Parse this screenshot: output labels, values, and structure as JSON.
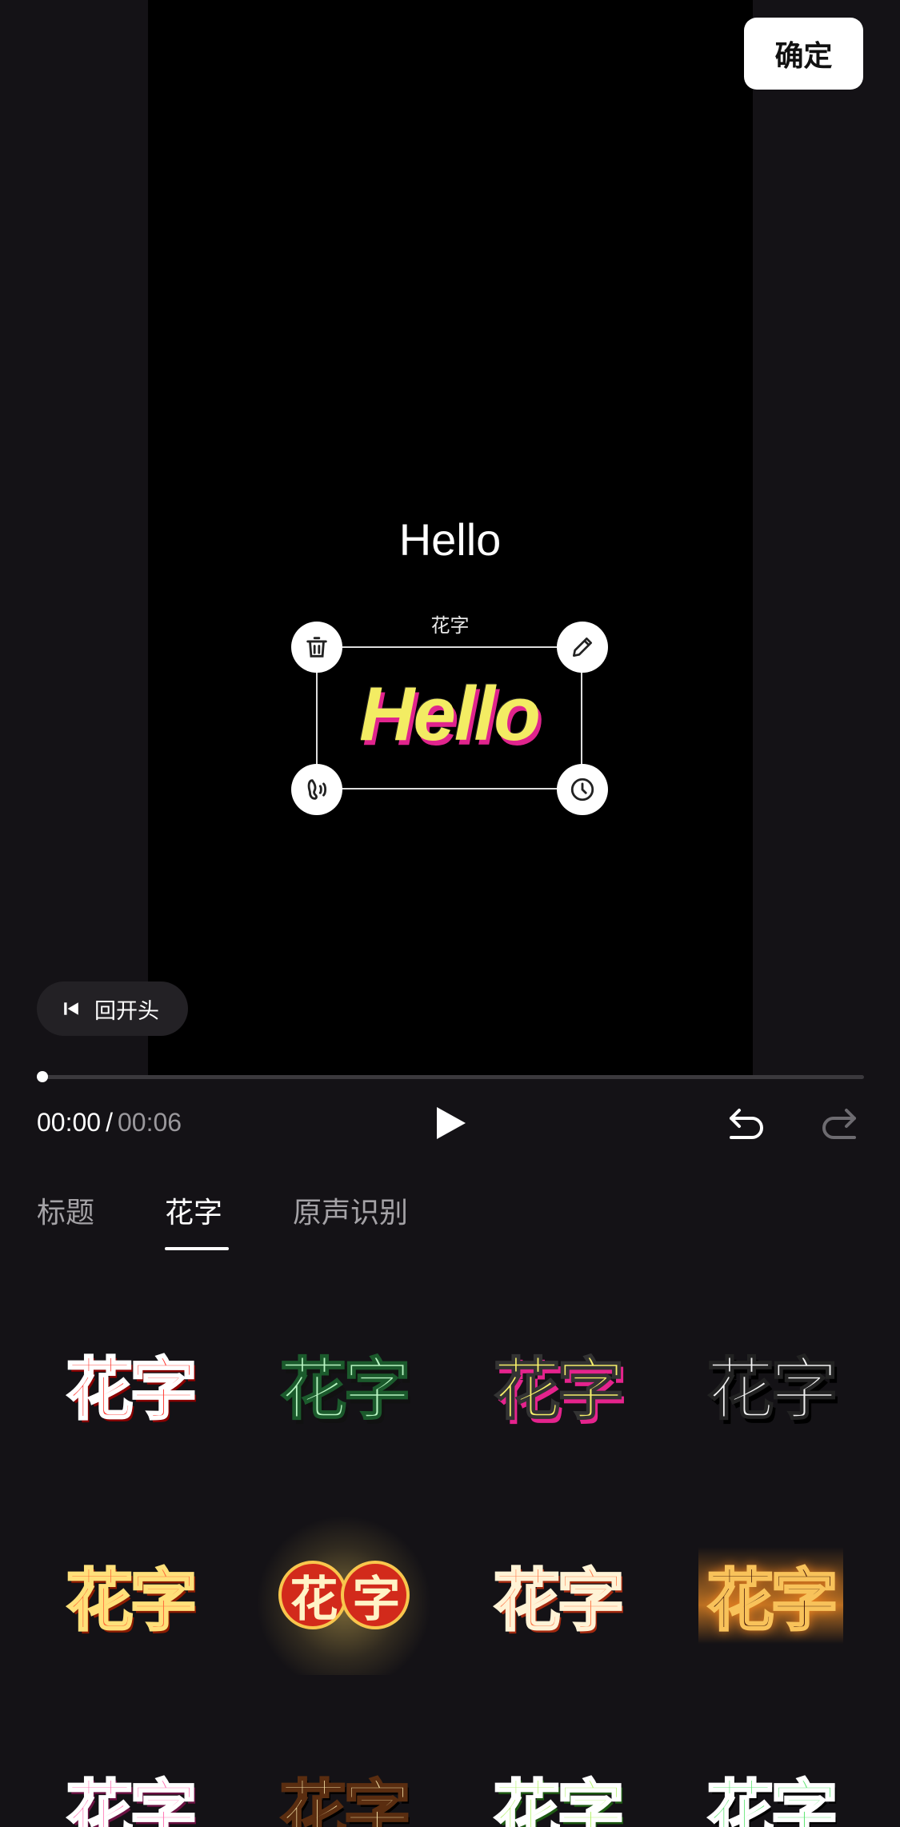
{
  "header": {
    "confirm_label": "确定"
  },
  "canvas": {
    "plain_text": "Hello",
    "selection": {
      "label": "花字",
      "text": "Hello"
    }
  },
  "player": {
    "back_to_start_label": "回开头",
    "current_time": "00:00",
    "separator": "/",
    "total_time": "00:06",
    "progress": 0
  },
  "tabs": [
    {
      "label": "标题",
      "active": false
    },
    {
      "label": "花字",
      "active": true
    },
    {
      "label": "原声识别",
      "active": false
    }
  ],
  "stickers": [
    {
      "text": "花字",
      "style": "red-white-outline"
    },
    {
      "text": "花字",
      "style": "mint-green"
    },
    {
      "text": "花字",
      "style": "yellow-pink-shadow"
    },
    {
      "text": "花字",
      "style": "white-black-shadow"
    },
    {
      "text": "花字",
      "style": "orange-gold"
    },
    {
      "text": "花字",
      "style": "red-discs-burst"
    },
    {
      "text": "花字",
      "style": "coral-sparkle"
    },
    {
      "text": "花字",
      "style": "brown-flame"
    },
    {
      "text": "花字",
      "style": "pink-burst"
    },
    {
      "text": "花字",
      "style": "cream-burst"
    },
    {
      "text": "花字",
      "style": "lime-sparkle"
    },
    {
      "text": "花字",
      "style": "green-white"
    }
  ],
  "colors": {
    "background": "#141216",
    "preview": "#000000",
    "accent_pink": "#e0248d",
    "accent_yellow": "#f3ec63"
  }
}
